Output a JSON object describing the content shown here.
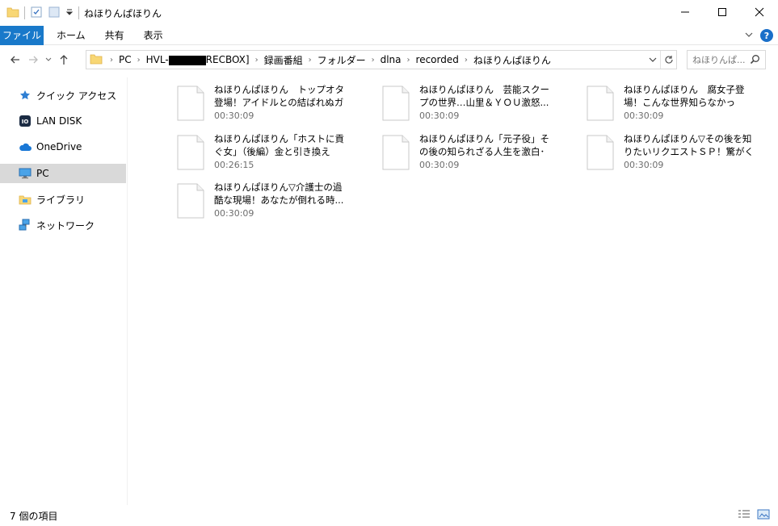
{
  "window": {
    "title": "ねほりんぱほりん"
  },
  "ribbon": {
    "tabs": [
      "ファイル",
      "ホーム",
      "共有",
      "表示"
    ],
    "help_label": "?"
  },
  "address": {
    "crumbs": [
      "PC",
      "HVL-",
      "RECBOX]",
      "録画番組",
      "フォルダー",
      "dlna",
      "recorded",
      "ねほりんぱほりん"
    ],
    "search_placeholder": "ねほりんぱ..."
  },
  "sidebar": {
    "items": [
      {
        "label": "クイック アクセス",
        "icon": "star-icon"
      },
      {
        "label": "LAN DISK",
        "icon": "lan-disk-icon"
      },
      {
        "label": "OneDrive",
        "icon": "cloud-icon"
      },
      {
        "label": "PC",
        "icon": "computer-icon",
        "selected": true
      },
      {
        "label": "ライブラリ",
        "icon": "library-icon"
      },
      {
        "label": "ネットワーク",
        "icon": "network-icon"
      }
    ]
  },
  "files": [
    {
      "name": "ねほりんぱほりん　トップオタ登場！アイドルとの結ばれぬガチ...",
      "duration": "00:30:09"
    },
    {
      "name": "ねほりんぱほりん　芸能スクープの世界…山里＆ＹＯＵ激怒...",
      "duration": "00:30:09"
    },
    {
      "name": "ねほりんぱほりん　腐女子登場！こんな世界知らなかった......",
      "duration": "00:30:09"
    },
    {
      "name": "ねほりんぱほりん「ホストに貢ぐ女」（後編）金と引き換えの...",
      "duration": "00:26:15"
    },
    {
      "name": "ねほりんぱほりん「元子役」その後の知られざる人生を激白･",
      "duration": "00:30:09"
    },
    {
      "name": "ねほりんぱほりん▽その後を知りたいリクエストＳＰ！驚がくと...",
      "duration": "00:30:09"
    },
    {
      "name": "ねほりんぱほりん▽介護士の過酷な現場！あなたが倒れる時...",
      "duration": "00:30:09"
    }
  ],
  "status": {
    "item_count": "7 個の項目"
  },
  "colors": {
    "accent": "#1979ca",
    "selected_bg": "#d9d9d9"
  }
}
